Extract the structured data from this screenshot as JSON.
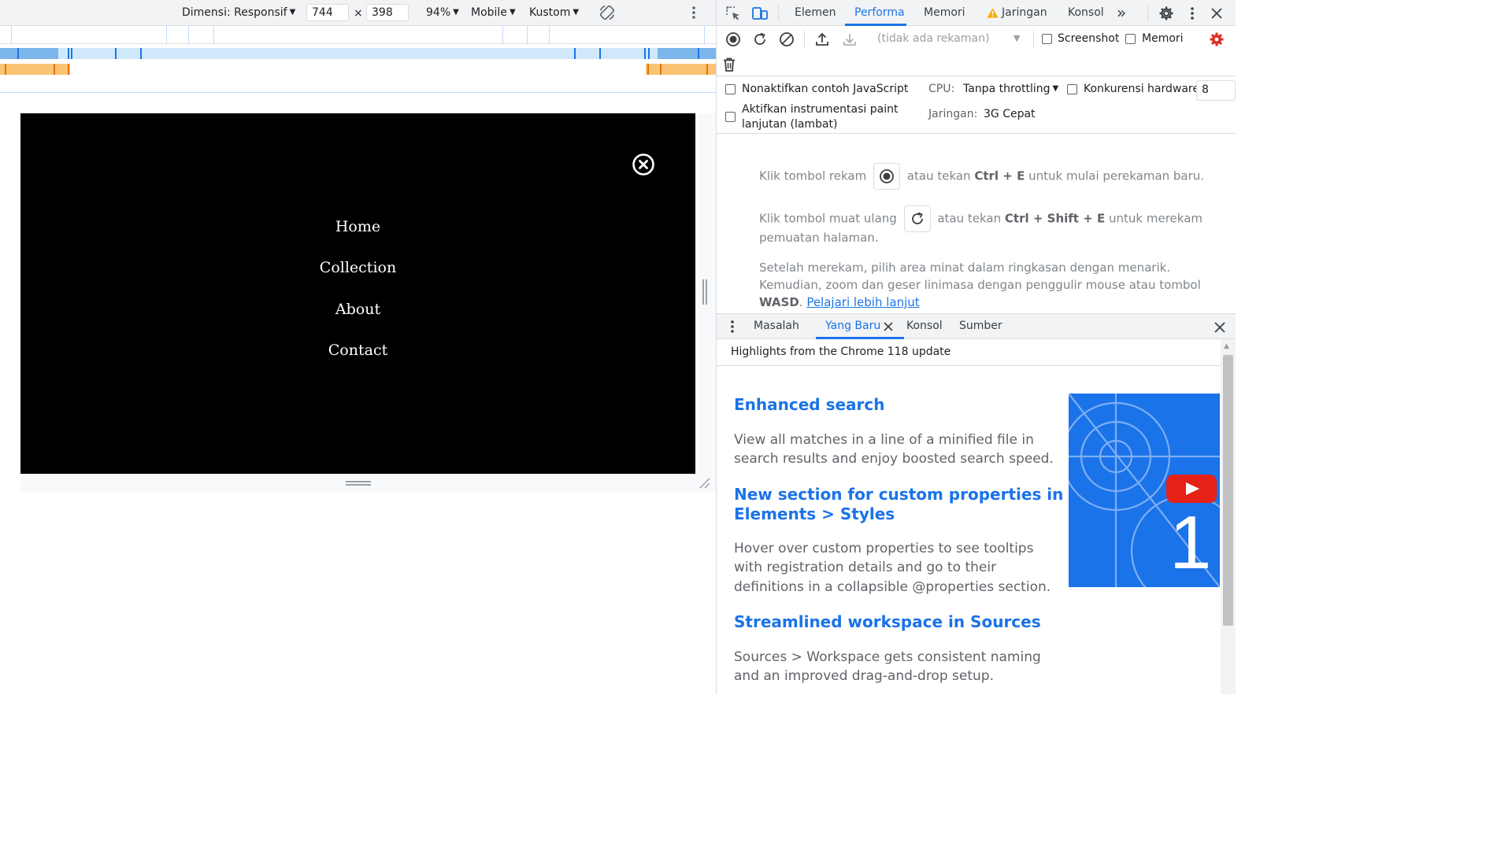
{
  "emulation": {
    "dimensions_label": "Dimensi: Responsif",
    "width_value": "744",
    "times_sign": "×",
    "height_value": "398",
    "zoom_label": "94%",
    "device_type_label": "Mobile",
    "throttle_label": "Kustom"
  },
  "site": {
    "nav": [
      "Home",
      "Collection",
      "About",
      "Contact"
    ]
  },
  "devtools": {
    "tabs": [
      "Elemen",
      "Performa",
      "Memori",
      "Jaringan",
      "Konsol"
    ],
    "more_tabs": "»",
    "performance": {
      "recording_placeholder": "(tidak ada rekaman)",
      "screenshot_label": "Screenshot",
      "memory_label": "Memori",
      "disable_js_samples_label": "Nonaktifkan contoh JavaScript",
      "paint_instrumentation_label_1": "Aktifkan instrumentasi paint",
      "paint_instrumentation_label_2": "lanjutan (lambat)",
      "cpu_label": "CPU:",
      "cpu_value": "Tanpa throttling",
      "hw_concurrency_label": "Konkurensi hardware",
      "hw_concurrency_value": "8",
      "network_label": "Jaringan:",
      "network_value": "3G Cepat"
    },
    "landing": {
      "record_prefix": "Klik tombol rekam",
      "record_mid": "atau tekan",
      "record_shortcut": "Ctrl + E",
      "record_suffix": "untuk mulai perekaman baru.",
      "reload_prefix": "Klik tombol muat ulang",
      "reload_mid": "atau tekan",
      "reload_shortcut": "Ctrl + Shift + E",
      "reload_suffix": "untuk merekam",
      "reload_line2": "pemuatan halaman.",
      "after_line1": "Setelah merekam, pilih area minat dalam ringkasan dengan menarik.",
      "after_line2": "Kemudian, zoom dan geser linimasa dengan penggulir mouse atau tombol",
      "after_keys": "WASD",
      "after_period": ".",
      "learn_more": "Pelajari lebih lanjut"
    },
    "drawer": {
      "tabs": [
        "Masalah",
        "Yang Baru",
        "Konsol",
        "Sumber"
      ],
      "whats_new_header": "Highlights from the Chrome 118 update",
      "items": [
        {
          "title": "Enhanced search",
          "desc_1": "View all matches in a line of a minified file in",
          "desc_2": "search results and enjoy boosted search speed."
        },
        {
          "title_1": "New section for custom properties in",
          "title_2": "Elements > Styles",
          "desc_1": "Hover over custom properties to see tooltips",
          "desc_2": "with registration details and go to their",
          "desc_3": "definitions in a collapsible @properties section."
        },
        {
          "title": "Streamlined workspace in Sources",
          "desc_1": "Sources > Workspace gets consistent naming",
          "desc_2": "and an improved drag-and-drop setup."
        }
      ],
      "video_badge": "1"
    }
  },
  "colors": {
    "accent": "#1a73e8",
    "warning": "#f9ab00",
    "record_red": "#d93025"
  }
}
